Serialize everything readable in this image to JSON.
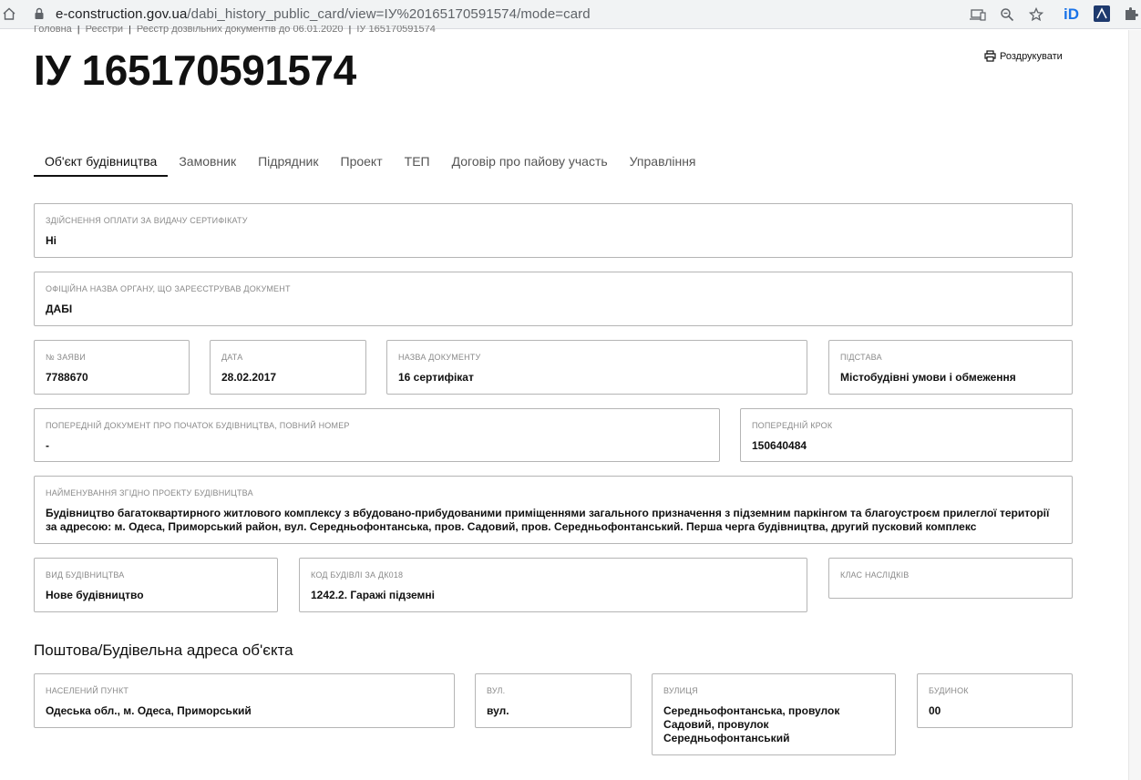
{
  "browser": {
    "url_host": "e-construction.gov.ua",
    "url_path": "/dabi_history_public_card/view=ІУ%20165170591574/mode=card",
    "extension_id_label": "iD"
  },
  "breadcrumb": [
    "Головна",
    "Реєстри",
    "Реєстр дозвільних документів до 06.01.2020",
    "ІУ 165170591574"
  ],
  "page": {
    "title": "ІУ 165170591574",
    "print_label": "Роздрукувати"
  },
  "tabs": [
    {
      "label": "Об'єкт будівництва",
      "active": true
    },
    {
      "label": "Замовник",
      "active": false
    },
    {
      "label": "Підрядник",
      "active": false
    },
    {
      "label": "Проект",
      "active": false
    },
    {
      "label": "ТЕП",
      "active": false
    },
    {
      "label": "Договір про пайову участь",
      "active": false
    },
    {
      "label": "Управління",
      "active": false
    }
  ],
  "fields": {
    "payment": {
      "label": "Здійснення оплати за видачу сертифікату",
      "value": "Ні"
    },
    "authority": {
      "label": "Офіційна назва органу, що зареєстрував документ",
      "value": "ДАБІ"
    },
    "application_no": {
      "label": "№ заяви",
      "value": "7788670"
    },
    "date": {
      "label": "Дата",
      "value": "28.02.2017"
    },
    "doc_name": {
      "label": "Назва документу",
      "value": "16 сертифікат"
    },
    "basis": {
      "label": "Підстава",
      "value": "Містобудівні умови і обмеження"
    },
    "prev_doc": {
      "label": "Попередній документ про початок будівництва, повний номер",
      "value": "-"
    },
    "prev_step": {
      "label": "Попередній крок",
      "value": "150640484"
    },
    "project_name": {
      "label": "Найменування згідно проекту будівництва",
      "value": "Будівництво багатоквартирного житлового комплексу з вбудовано-прибудованими приміщеннями загального призначення з підземним паркінгом та благоустроєм прилеглої території за адресою: м. Одеса, Приморський район, вул. Середньофонтанська, пров. Садовий, пров. Середньофонтанський. Перша черга будівництва, другий пусковий комплекс"
    },
    "construction_type": {
      "label": "Вид будівництва",
      "value": "Нове будівництво"
    },
    "building_code": {
      "label": "Код будівлі за ДК018",
      "value": "1242.2. Гаражі підземні"
    },
    "consequence_class": {
      "label": "Клас наслідків",
      "value": ""
    }
  },
  "address_section": {
    "title": "Поштова/Будівельна адреса об'єкта",
    "settlement": {
      "label": "Населений пункт",
      "value": "Одеська обл., м. Одеса, Приморський"
    },
    "street_type": {
      "label": "Вул.",
      "value": "вул."
    },
    "street": {
      "label": "Вулиця",
      "value": "Середньофонтанська, провулок Садовий, провулок Середньофонтанський"
    },
    "house": {
      "label": "Будинок",
      "value": "00"
    }
  }
}
